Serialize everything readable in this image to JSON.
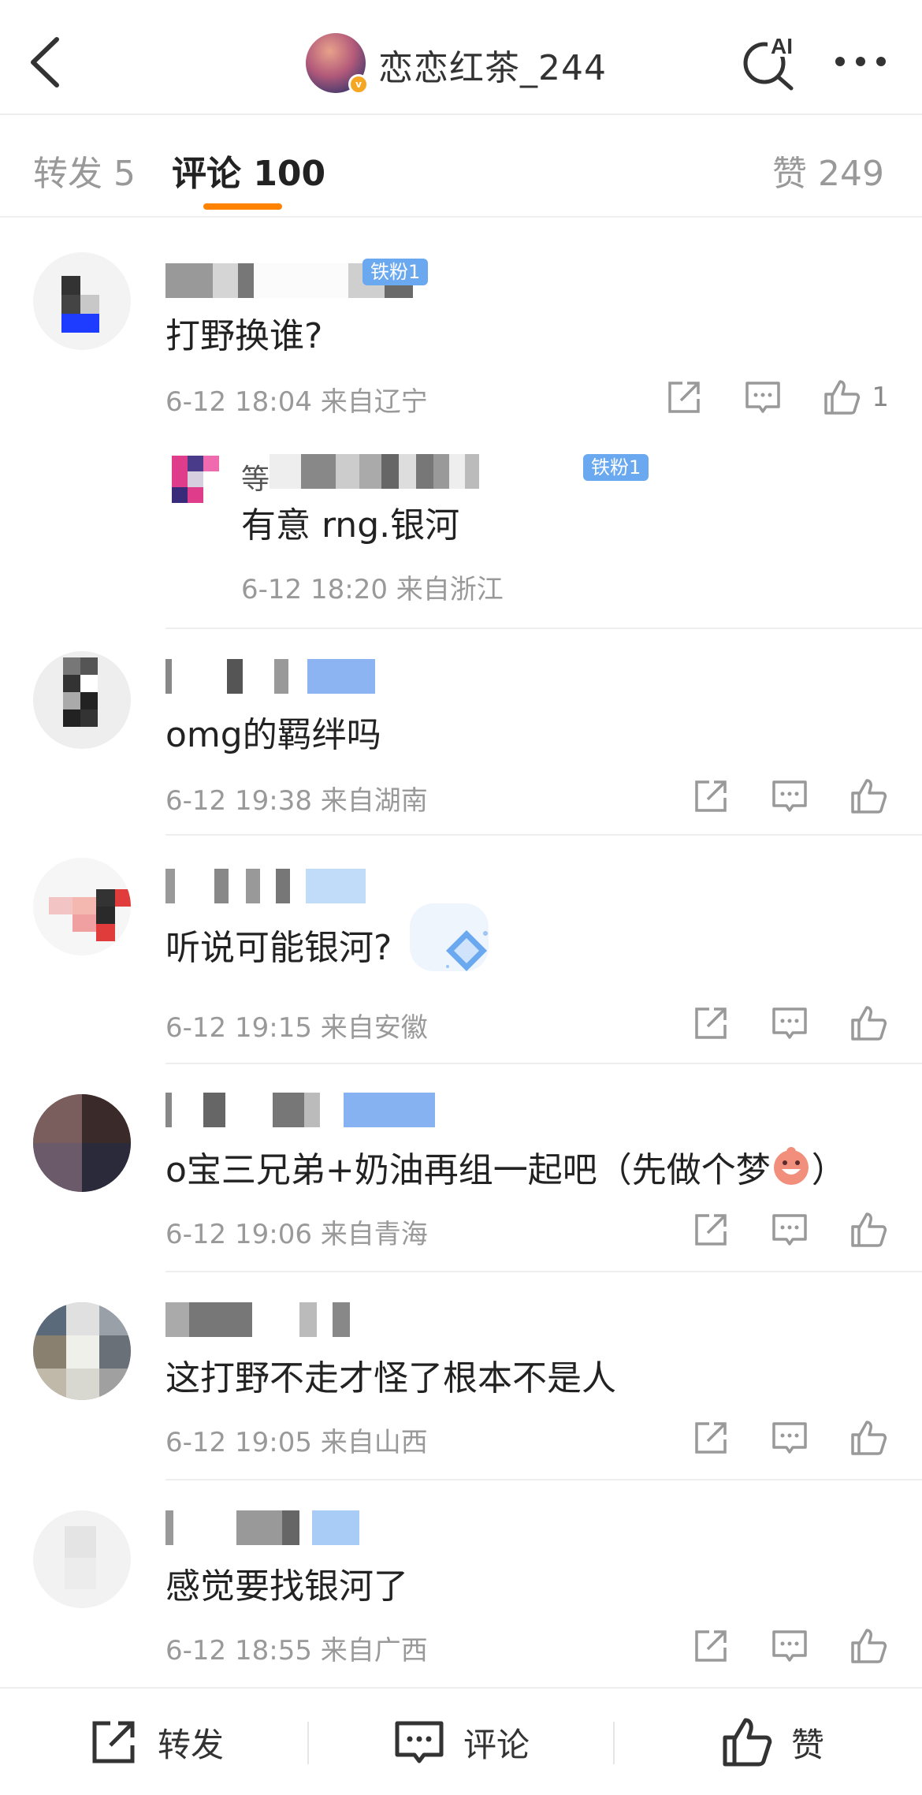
{
  "header": {
    "title": "恋恋红茶_244",
    "ai_label": "AI"
  },
  "tabs": {
    "repost": "转发 5",
    "comments": "评论 100",
    "likes": "赞 249"
  },
  "comments": [
    {
      "text": "打野换谁?",
      "meta": "6-12 18:04 来自辽宁",
      "likes": "1",
      "badge": "铁粉1"
    },
    {
      "text": "omg的羁绊吗",
      "meta": "6-12 19:38 来自湖南"
    },
    {
      "text": "听说可能银河?",
      "meta": "6-12 19:15 来自安徽"
    },
    {
      "text": "o宝三兄弟+奶油再组一起吧（先做个梦",
      "text_end": "）",
      "meta": "6-12 19:06 来自青海"
    },
    {
      "text": "这打野不走才怪了根本不是人",
      "meta": "6-12 19:05 来自山西"
    },
    {
      "text": "感觉要找银河了",
      "meta": "6-12 18:55 来自广西"
    }
  ],
  "reply": {
    "text": "有意 rng.银河",
    "meta": "6-12 18:20 来自浙江",
    "badge": "铁粉1",
    "name_initial": "等"
  },
  "bottom_bar": {
    "repost": "转发",
    "comment": "评论",
    "like": "赞"
  },
  "colors": {
    "accent": "#ff8200",
    "badge": "#6aa8ef",
    "meta": "#999999"
  }
}
